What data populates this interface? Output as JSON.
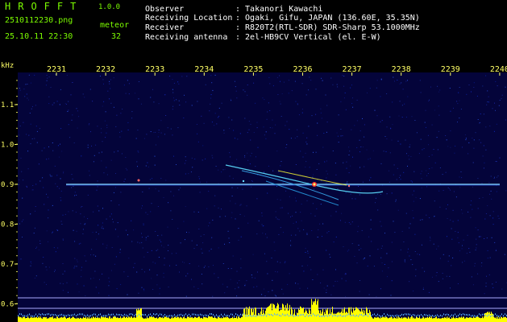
{
  "header": {
    "logo": "HROFFT",
    "version": "1.0.0",
    "filename": "2510112230.png",
    "datetime": "25.10.11 22:30",
    "meteor_label": "meteor",
    "meteor_count": "32",
    "observer_label": "Observer",
    "observer_value": ": Takanori Kawachi",
    "location_label": "Receiving Location",
    "location_value": ": Ogaki, Gifu, JAPAN (136.60E, 35.35N)",
    "receiver_label": "Receiver",
    "receiver_value": ": R820T2(RTL-SDR) SDR-Sharp 53.1000MHz",
    "antenna_label": "Receiving antenna",
    "antenna_value": ": 2el-HB9CV Vertical (el. E-W)"
  },
  "axis": {
    "unit": "kHz",
    "x_ticks": [
      "2231",
      "2232",
      "2233",
      "2234",
      "2235",
      "2236",
      "2237",
      "2238",
      "2239",
      "2240"
    ],
    "y_ticks": [
      "1.1",
      "1.0",
      "0.9",
      "0.8",
      "0.7",
      "0.6"
    ]
  },
  "colors": {
    "background": "#04043a",
    "carrier": "#88ddff",
    "meteor": "#ffff33",
    "histogram": "#ffff00",
    "text_green": "#7CFC00",
    "axis_text": "#ffff66"
  },
  "chart_data": {
    "type": "heatmap",
    "xlabel": "",
    "ylabel": "kHz",
    "x_ticks": [
      "2231",
      "2232",
      "2233",
      "2234",
      "2235",
      "2236",
      "2237",
      "2238",
      "2239",
      "2240"
    ],
    "y_range": [
      0.6,
      1.12
    ],
    "y_ticks": [
      1.1,
      1.0,
      0.9,
      0.8,
      0.7,
      0.6
    ],
    "carrier_frequency_khz": 0.9,
    "meteor_count": 32
  }
}
